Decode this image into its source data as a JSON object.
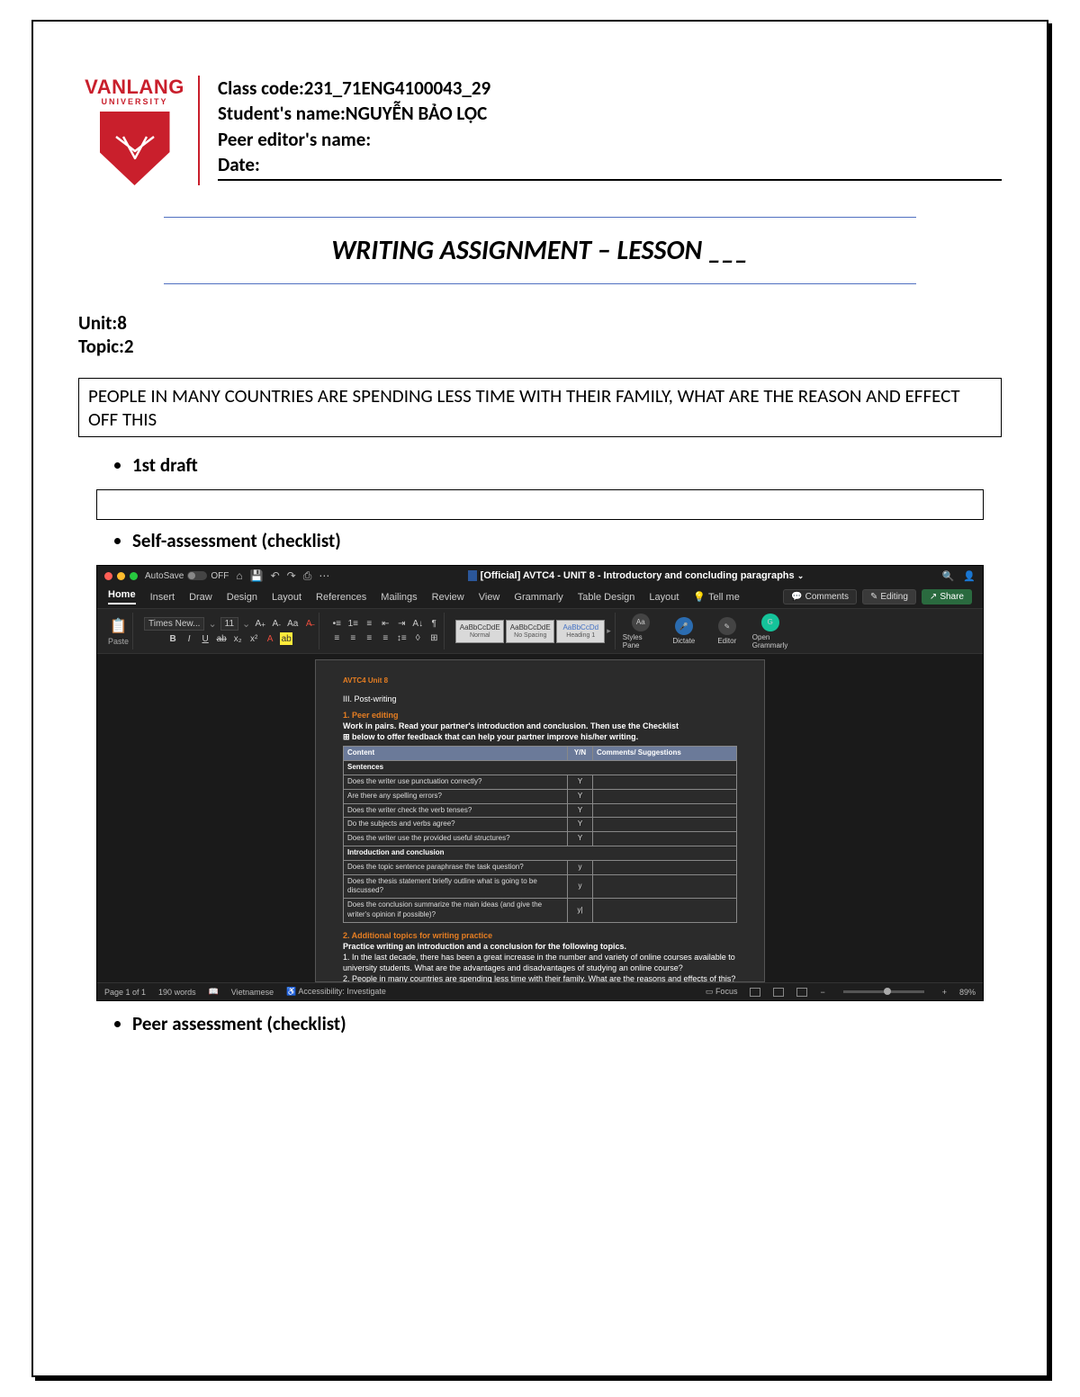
{
  "logo": {
    "name": "VANLANG",
    "sub": "UNIVERSITY"
  },
  "header": {
    "class_code_label": "Class code:",
    "class_code": "231_71ENG4100043_29",
    "student_label": "Student's name:",
    "student_name": "NGUYỄN BẢO LỘC",
    "peer_editor_label": "Peer editor's name:",
    "peer_editor_name": "",
    "date_label": "Date:",
    "date_value": ""
  },
  "title": "WRITING ASSIGNMENT – LESSON ___",
  "unit_label": "Unit:",
  "unit_value": "8",
  "topic_label": "Topic:",
  "topic_value": "2",
  "topic_text": "PEOPLE IN MANY COUNTRIES ARE SPENDING LESS TIME WITH THEIR FAMILY, WHAT ARE THE REASON AND EFFECT OFF THIS",
  "bullets": {
    "first_draft": "1st draft",
    "self_assessment": "Self-assessment (checklist)",
    "peer_assessment": "Peer assessment (checklist)"
  },
  "word": {
    "autosave": "AutoSave",
    "autosave_state": "OFF",
    "doc_title": "[Official] AVTC4 - UNIT 8 - Introductory and concluding paragraphs",
    "tabs": [
      "Home",
      "Insert",
      "Draw",
      "Design",
      "Layout",
      "References",
      "Mailings",
      "Review",
      "View",
      "Grammarly",
      "Table Design",
      "Layout"
    ],
    "tellme": "Tell me",
    "top_buttons": {
      "comments": "Comments",
      "editing": "Editing",
      "share": "Share"
    },
    "ribbon": {
      "paste": "Paste",
      "font_name": "Times New...",
      "font_size": "11",
      "styles": {
        "normal": "Normal",
        "no_spacing": "No Spacing",
        "heading1": "Heading 1",
        "sample": "AaBbCcDdE",
        "sample_h": "AaBbCcDd"
      },
      "styles_pane": "Styles Pane",
      "dictate": "Dictate",
      "editor": "Editor",
      "grammarly": "Open Grammarly"
    },
    "doc": {
      "unit_line": "AVTC4 Unit 8",
      "section": "III. Post-writing",
      "h1": "1. Peer editing",
      "p1a": "Work in pairs. Read your partner's introduction and conclusion. Then use the Checklist",
      "p1b": "below to offer feedback that can help your partner improve his/her writing.",
      "table_headers": {
        "content": "Content",
        "yn": "Y/N",
        "sug": "Comments/ Suggestions"
      },
      "rows": [
        {
          "content": "Sentences",
          "yn": "",
          "hdr": true
        },
        {
          "content": "Does the writer use punctuation correctly?",
          "yn": "Y"
        },
        {
          "content": "Are there any spelling errors?",
          "yn": "Y"
        },
        {
          "content": "Does the writer check the verb tenses?",
          "yn": "Y"
        },
        {
          "content": "Do the subjects and verbs agree?",
          "yn": "Y"
        },
        {
          "content": "Does the writer use the provided useful structures?",
          "yn": "Y"
        },
        {
          "content": "Introduction and conclusion",
          "yn": "",
          "hdr": true
        },
        {
          "content": "Does the topic sentence paraphrase the task question?",
          "yn": "y"
        },
        {
          "content": "Does the thesis statement briefly outline what is going to be discussed?",
          "yn": "y"
        },
        {
          "content": "Does the conclusion summarize the main ideas (and give the writer's opinion if possible)?",
          "yn": "y|"
        }
      ],
      "h2": "2. Additional topics for writing practice",
      "p2": "Practice writing an introduction and a conclusion for the following topics.",
      "p3": "1. In the last decade, there has been a great increase in the number and variety of online courses available to university students. What are the advantages and disadvantages of studying an online course?",
      "p4": "2. People in many countries are spending less time with their family. What are the reasons and effects of this?"
    },
    "status": {
      "page": "Page 1 of 1",
      "words": "190 words",
      "lang": "Vietnamese",
      "access": "Accessibility: Investigate",
      "focus": "Focus",
      "zoom": "89%"
    }
  }
}
